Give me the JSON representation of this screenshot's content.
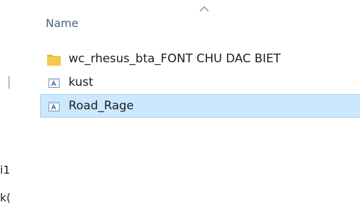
{
  "header": {
    "column_name": "Name",
    "sort_indicator": "sort-ascending-chevron"
  },
  "files": [
    {
      "name": "wc_rhesus_bta_FONT CHU DAC BIET",
      "type": "folder",
      "icon": "folder-icon",
      "selected": false
    },
    {
      "name": "kust",
      "type": "font",
      "icon": "font-file-icon",
      "selected": false
    },
    {
      "name": "Road_Rage",
      "type": "font",
      "icon": "font-file-icon",
      "selected": true
    }
  ],
  "left_fragments": [
    "i1",
    "k("
  ],
  "colors": {
    "selection_background": "#cce8ff",
    "selection_border": "#99d1ff",
    "header_text": "#4c607a",
    "folder_yellow": "#f6c94e"
  }
}
